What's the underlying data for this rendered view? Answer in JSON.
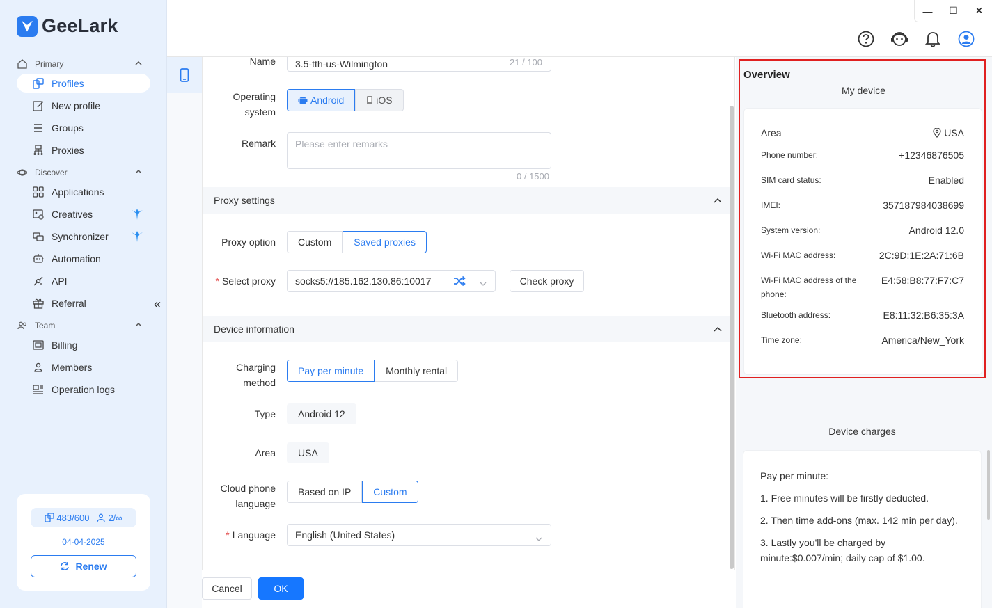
{
  "app": {
    "name": "GeeLark"
  },
  "sidebar": {
    "sections": [
      {
        "label": "Primary"
      },
      {
        "label": "Discover"
      },
      {
        "label": "Team"
      }
    ],
    "items": [
      {
        "label": "Profiles"
      },
      {
        "label": "New profile"
      },
      {
        "label": "Groups"
      },
      {
        "label": "Proxies"
      },
      {
        "label": "Applications"
      },
      {
        "label": "Creatives"
      },
      {
        "label": "Synchronizer"
      },
      {
        "label": "Automation"
      },
      {
        "label": "API"
      },
      {
        "label": "Referral"
      },
      {
        "label": "Billing"
      },
      {
        "label": "Members"
      },
      {
        "label": "Operation logs"
      }
    ],
    "collapse_glyph": "«",
    "account": {
      "profiles_count": "483/600",
      "members_count": "2/∞",
      "date": "04-04-2025",
      "renew_label": "Renew"
    }
  },
  "window": {
    "minimize": "—",
    "maximize": "☐",
    "close": "✕"
  },
  "form": {
    "name_label": "Name",
    "name_value": "3.5-tth-us-Wilmington",
    "name_count": "21 / 100",
    "os_label_1": "Operating",
    "os_label_2": "system",
    "os_android": "Android",
    "os_ios": "iOS",
    "remark_label": "Remark",
    "remark_placeholder": "Please enter remarks",
    "remark_count": "0 / 1500",
    "proxy_section": "Proxy settings",
    "proxy_option_label": "Proxy option",
    "proxy_custom": "Custom",
    "proxy_saved": "Saved proxies",
    "select_proxy_label": "Select proxy",
    "select_proxy_value": "socks5://185.162.130.86:10017",
    "check_proxy": "Check proxy",
    "device_section": "Device information",
    "charging_label_1": "Charging",
    "charging_label_2": "method",
    "charging_ppm": "Pay per minute",
    "charging_monthly": "Monthly rental",
    "type_label": "Type",
    "type_value": "Android 12",
    "area_label": "Area",
    "area_value": "USA",
    "cloud_lang_label_1": "Cloud phone",
    "cloud_lang_label_2": "language",
    "cloud_lang_ip": "Based on IP",
    "cloud_lang_custom": "Custom",
    "language_label": "Language",
    "language_value": "English (United States)",
    "cancel": "Cancel",
    "ok": "OK"
  },
  "overview": {
    "title": "Overview",
    "my_device": "My device",
    "rows": [
      {
        "key": "Area",
        "value": "USA"
      },
      {
        "key": "Phone number:",
        "value": "+12346876505"
      },
      {
        "key": "SIM card status:",
        "value": "Enabled"
      },
      {
        "key": "IMEI:",
        "value": "357187984038699"
      },
      {
        "key": "System version:",
        "value": "Android 12.0"
      },
      {
        "key": "Wi-Fi MAC address:",
        "value": "2C:9D:1E:2A:71:6B"
      },
      {
        "key": "Wi-Fi MAC address of the phone:",
        "value": "E4:58:B8:77:F7:C7"
      },
      {
        "key": "Bluetooth address:",
        "value": "E8:11:32:B6:35:3A"
      },
      {
        "key": "Time zone:",
        "value": "America/New_York"
      }
    ],
    "charges_title": "Device charges",
    "charges": [
      "Pay per minute:",
      "1. Free minutes will be firstly deducted.",
      "2. Then time add-ons (max. 142 min per day).",
      "3. Lastly you'll be charged by minute:$0.007/min; daily cap of $1.00."
    ]
  },
  "colors": {
    "accent": "#2b7cf0",
    "highlight_border": "#e02020",
    "sidebar_bg": "#e8f1fd"
  }
}
